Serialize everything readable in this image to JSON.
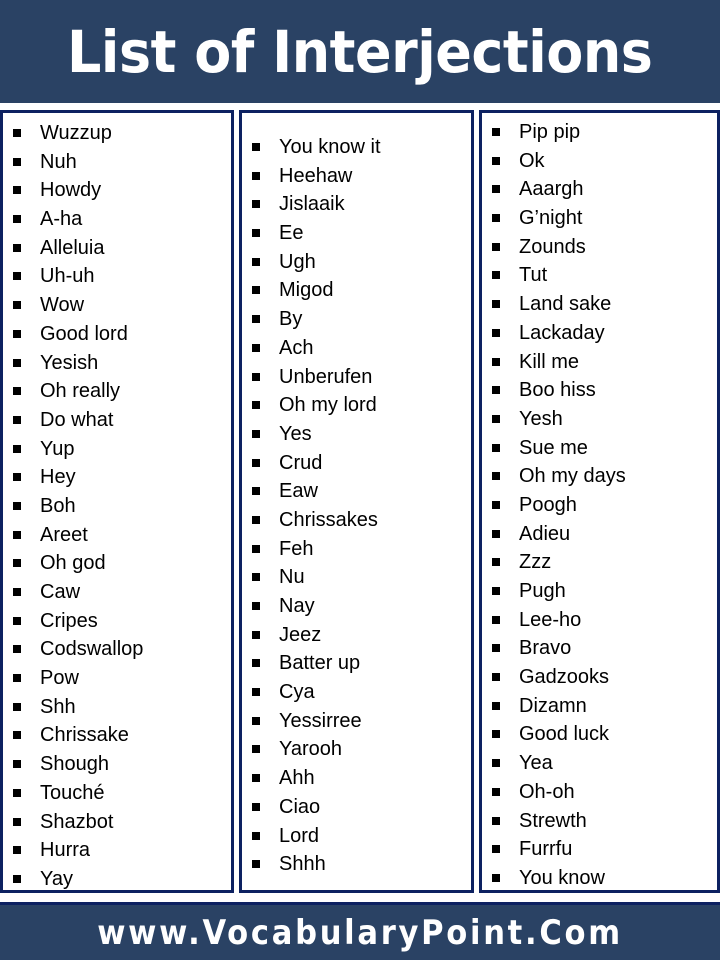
{
  "header": {
    "title": "List of Interjections"
  },
  "columns": [
    {
      "items": [
        "Wuzzup",
        "Nuh",
        "Howdy",
        "A-ha",
        "Alleluia",
        "Uh-uh",
        "Wow",
        "Good lord",
        "Yesish",
        "Oh really",
        "Do what",
        "Yup",
        "Hey",
        "Boh",
        "Areet",
        "Oh god",
        "Caw",
        "Cripes",
        "Codswallop",
        "Pow",
        "Shh",
        "Chrissake",
        "Shough",
        "Touché",
        "Shazbot",
        "Hurra",
        "Yay"
      ]
    },
    {
      "items": [
        "You know it",
        "Heehaw",
        "Jislaaik",
        "Ee",
        "Ugh",
        "Migod",
        "By",
        "Ach",
        "Unberufen",
        "Oh my lord",
        "Yes",
        "Crud",
        "Eaw",
        "Chrissakes",
        "Feh",
        "Nu",
        "Nay",
        "Jeez",
        "Batter up",
        "Cya",
        "Yessirree",
        "Yarooh",
        "Ahh",
        "Ciao",
        "Lord",
        "Shhh"
      ]
    },
    {
      "items": [
        "Pip pip",
        "Ok",
        "Aaargh",
        "G’night",
        "Zounds",
        "Tut",
        "Land sake",
        "Lackaday",
        "Kill me",
        "Boo hiss",
        "Yesh",
        "Sue me",
        "Oh my days",
        "Poogh",
        "Adieu",
        "Zzz",
        "Pugh",
        "Lee-ho",
        "Bravo",
        "Gadzooks",
        "Dizamn",
        "Good luck",
        "Yea",
        "Oh-oh",
        "Strewth",
        "Furrfu",
        "You know"
      ]
    }
  ],
  "footer": {
    "website": "www.VocabularyPoint.Com"
  },
  "colors": {
    "banner": "#2a4264",
    "border": "#0d2161",
    "text": "#000000",
    "banner_text": "#ffffff"
  }
}
